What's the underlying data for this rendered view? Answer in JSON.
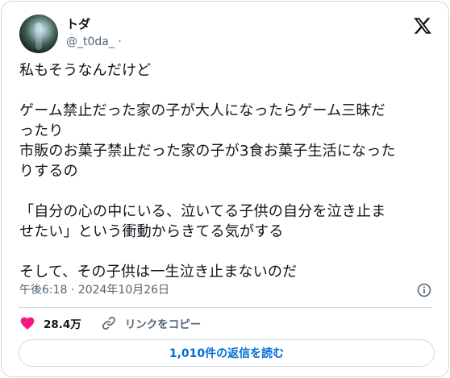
{
  "author": {
    "display_name": "トダ",
    "handle": "@_t0da_",
    "separator": "·"
  },
  "tweet": {
    "text": "私もそうなんだけど\n\nゲーム禁止だった家の子が大人になったらゲーム三昧だ\nったり\n市販のお菓子禁止だった家の子が3食お菓子生活になった\nりするの\n\n「自分の心の中にいる、泣いてる子供の自分を泣き止ま\nせたい」という衝動からきてる気がする\n\nそして、その子供は一生泣き止まないのだ",
    "timestamp": "午後6:18 · 2024年10月26日"
  },
  "actions": {
    "like_count": "28.4万",
    "copy_link_label": "リンクをコピー"
  },
  "replies_button": "1,010件の返信を読む",
  "icons": {
    "logo": "x-logo-icon",
    "like": "heart-icon",
    "copy": "link-icon",
    "info": "info-icon"
  },
  "colors": {
    "like": "#f91880",
    "link": "#006fd6",
    "secondary_text": "#536471"
  }
}
